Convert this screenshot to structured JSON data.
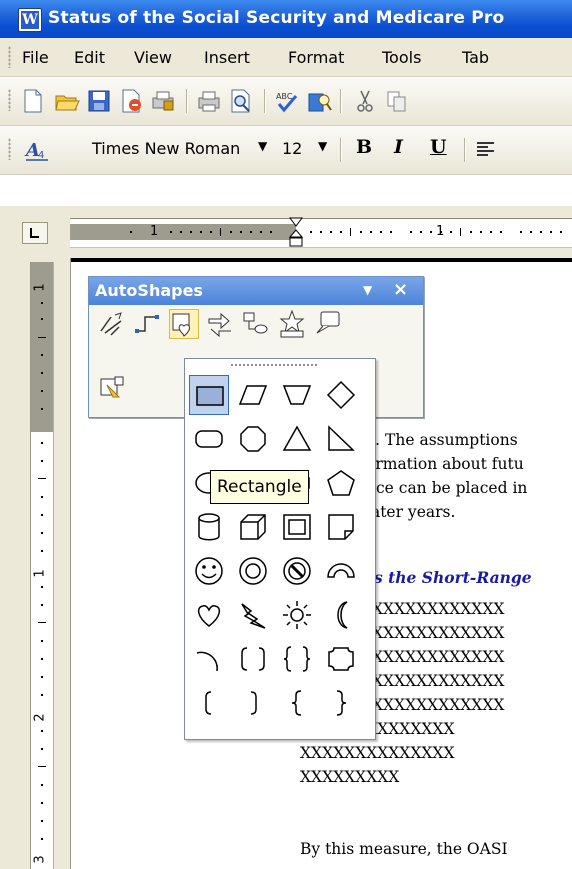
{
  "window": {
    "title": "Status of the Social Security and Medicare Pro"
  },
  "menu": [
    "File",
    "Edit",
    "View",
    "Insert",
    "Format",
    "Tools",
    "Tab"
  ],
  "standard_toolbar": {
    "icons": [
      "new-document-icon",
      "open-folder-icon",
      "save-icon",
      "permission-icon",
      "print-lock-icon",
      "print-icon",
      "print-preview-icon",
      "spelling-icon",
      "research-icon",
      "cut-icon",
      "copy-icon"
    ]
  },
  "formatting_toolbar": {
    "style_icon": "styles-icon",
    "font_name": "Times New Roman",
    "font_size": "12",
    "bold": "B",
    "italic": "I",
    "underline": "U"
  },
  "ruler": {
    "h_labels": [
      "1",
      "1"
    ],
    "v_labels": [
      "1",
      "1",
      "2",
      "3"
    ]
  },
  "autoshapes": {
    "title": "AutoShapes",
    "dropdown_glyph": "▼",
    "close_glyph": "×",
    "categories": [
      "lines-icon",
      "connectors-icon",
      "basic-shapes-icon",
      "block-arrows-icon",
      "flowchart-icon",
      "stars-banners-icon",
      "callouts-icon",
      "more-autoshapes-icon"
    ],
    "palette_title": "Basic Shapes",
    "tooltip": "Rectangle"
  },
  "document": {
    "lines": [
      "e. The assumptions",
      "ormation about futu",
      "nce can be placed in",
      "later years.",
      "s the Short-Range",
      "XXXXXXXXXXXX",
      "XXXXXXXXXXXX",
      "XXXXXXXXXXXX",
      "XXXXXXXXXXXX",
      "XXXXXXXXXXXX",
      "XXXXXXXXXXXXXX",
      "XXXXXXXXXXXXXX",
      "XXXXXXXXX",
      "By this measure, the OASI"
    ]
  },
  "colors": {
    "title_bar": "#0a4fd0",
    "heading_blue": "#1a1aa8",
    "selection": "#c1d2ee"
  }
}
